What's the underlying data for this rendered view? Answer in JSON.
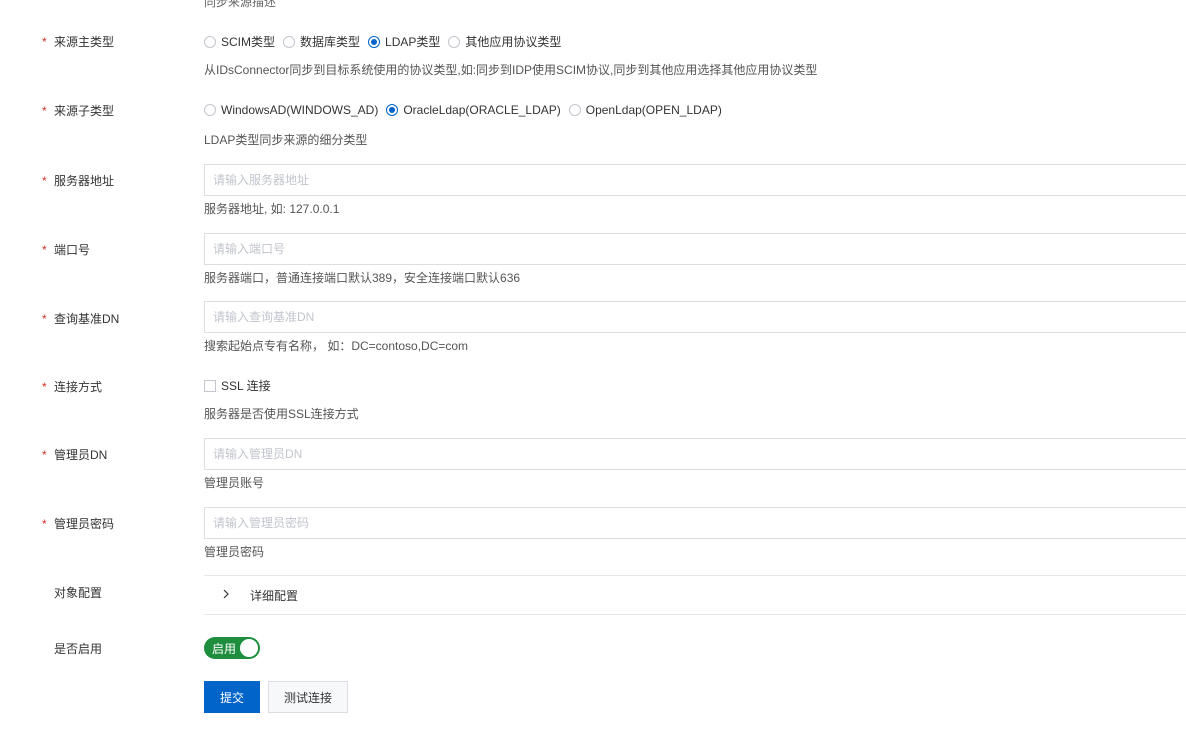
{
  "top_clipped_text": "同步来源描述",
  "fields": {
    "source_main_type": {
      "label": "来源主类型",
      "options": [
        "SCIM类型",
        "数据库类型",
        "LDAP类型",
        "其他应用协议类型"
      ],
      "selected": "LDAP类型",
      "help": "从IDsConnector同步到目标系统使用的协议类型,如:同步到IDP使用SCIM协议,同步到其他应用选择其他应用协议类型"
    },
    "source_sub_type": {
      "label": "来源子类型",
      "options": [
        "WindowsAD(WINDOWS_AD)",
        "OracleLdap(ORACLE_LDAP)",
        "OpenLdap(OPEN_LDAP)"
      ],
      "selected": "OracleLdap(ORACLE_LDAP)",
      "help": "LDAP类型同步来源的细分类型"
    },
    "server_address": {
      "label": "服务器地址",
      "placeholder": "请输入服务器地址",
      "value": "",
      "help": "服务器地址, 如: 127.0.0.1"
    },
    "port": {
      "label": "端口号",
      "placeholder": "请输入端口号",
      "value": "",
      "help": "服务器端口，普通连接端口默认389，安全连接端口默认636"
    },
    "base_dn": {
      "label": "查询基准DN",
      "placeholder": "请输入查询基准DN",
      "value": "",
      "help": "搜索起始点专有名称， 如：DC=contoso,DC=com"
    },
    "connection_method": {
      "label": "连接方式",
      "checkbox_label": "SSL 连接",
      "checked": false,
      "help": "服务器是否使用SSL连接方式"
    },
    "admin_dn": {
      "label": "管理员DN",
      "placeholder": "请输入管理员DN",
      "value": "",
      "help": "管理员账号"
    },
    "admin_password": {
      "label": "管理员密码",
      "placeholder": "请输入管理员密码",
      "value": "",
      "help": "管理员密码"
    },
    "object_config": {
      "label": "对象配置",
      "collapse_title": "详细配置",
      "icon": "chevron-right-icon"
    },
    "enabled": {
      "label": "是否启用",
      "switch_text": "启用",
      "on": true
    }
  },
  "buttons": {
    "submit": "提交",
    "test_connection": "测试连接"
  },
  "colors": {
    "primary": "#0064c8",
    "required_star": "#d93026",
    "switch_on": "#1e8e3e"
  }
}
